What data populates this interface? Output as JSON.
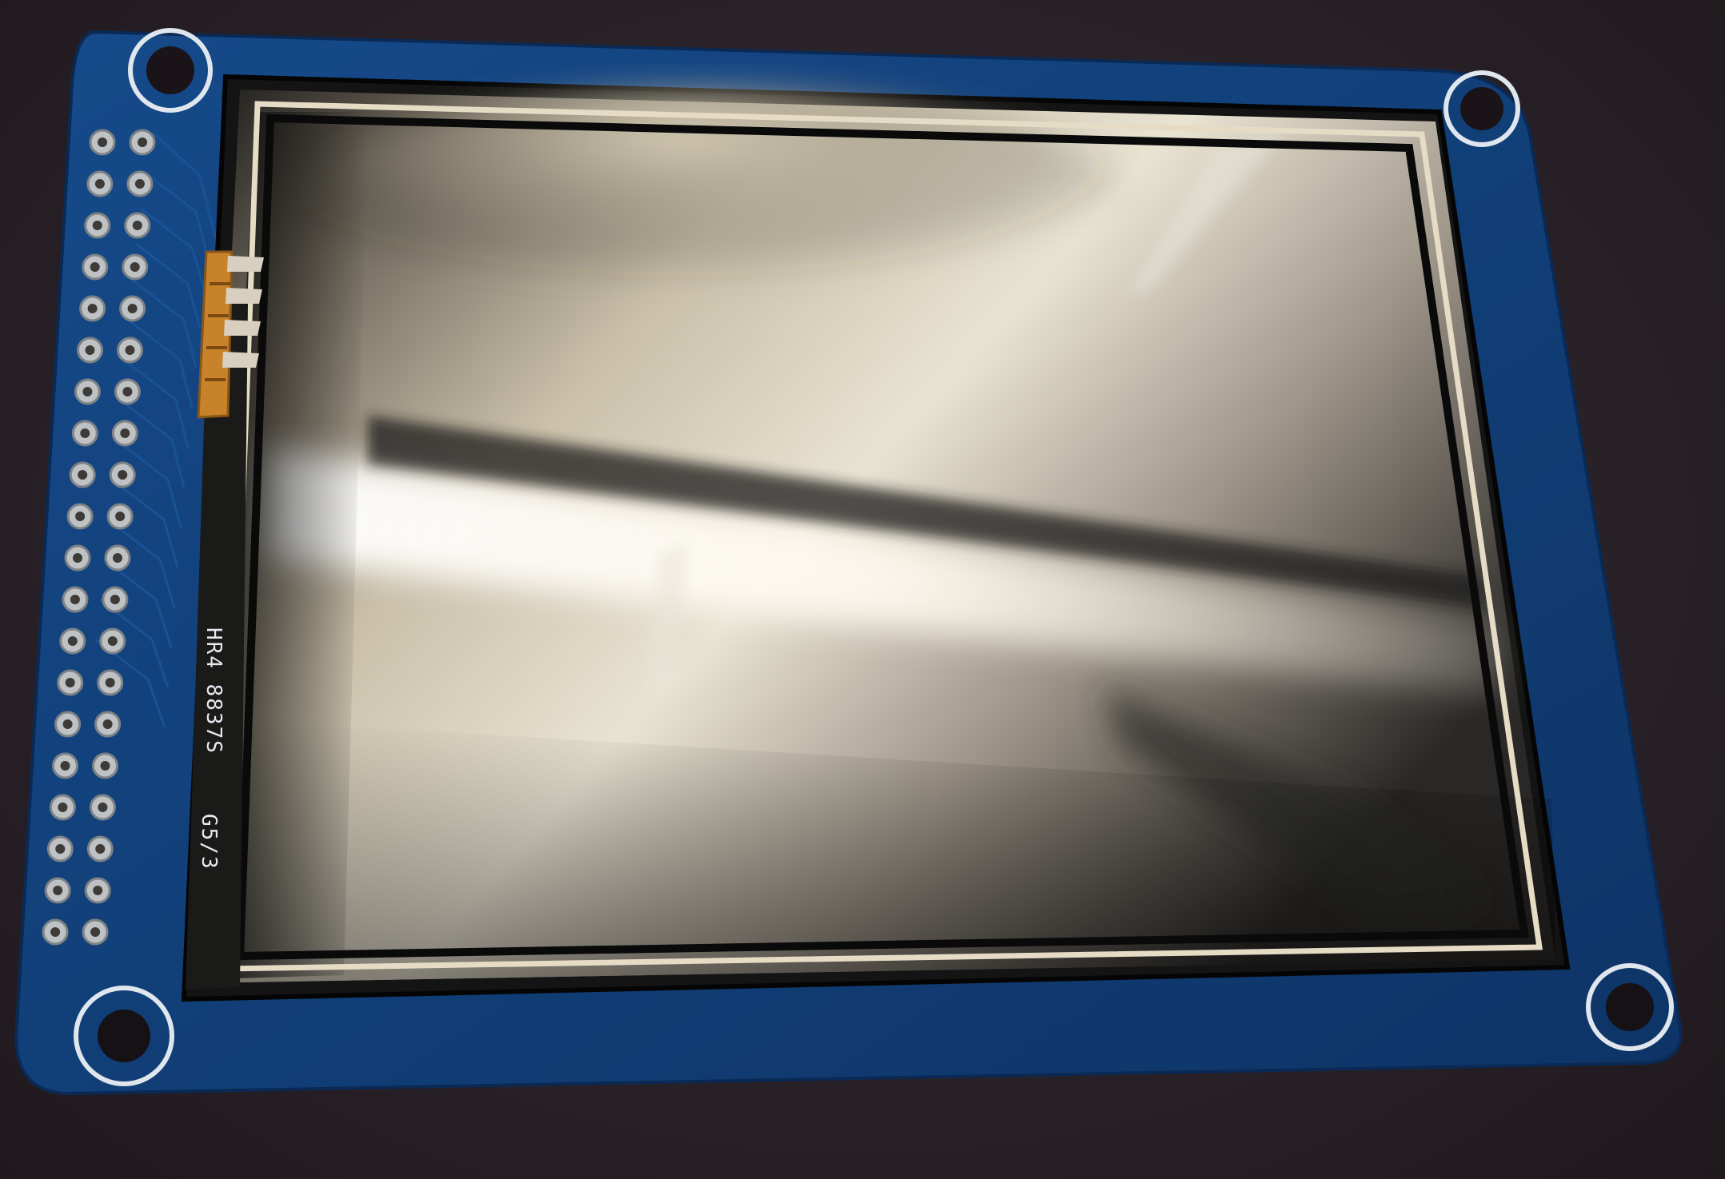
{
  "scene": {
    "subject": "tft-lcd-touchscreen-module",
    "colors": {
      "background": "#2a2229",
      "pcb": "#123f7c",
      "pcb_dark": "#0d2f5e",
      "silkscreen": "#e6e9ee",
      "pad": "#bfc2c4",
      "flex_cable": "#c8832a",
      "glass_frame": "#d8cdb4",
      "glass_border": "#0c0c0c"
    }
  },
  "silkscreen": {
    "code_top": "HR4 8837S",
    "code_bottom": "G5/3"
  },
  "header": {
    "rows": 20,
    "columns": 2
  },
  "mounting_holes": {
    "count": 4,
    "icon": "screw-hole-icon"
  }
}
